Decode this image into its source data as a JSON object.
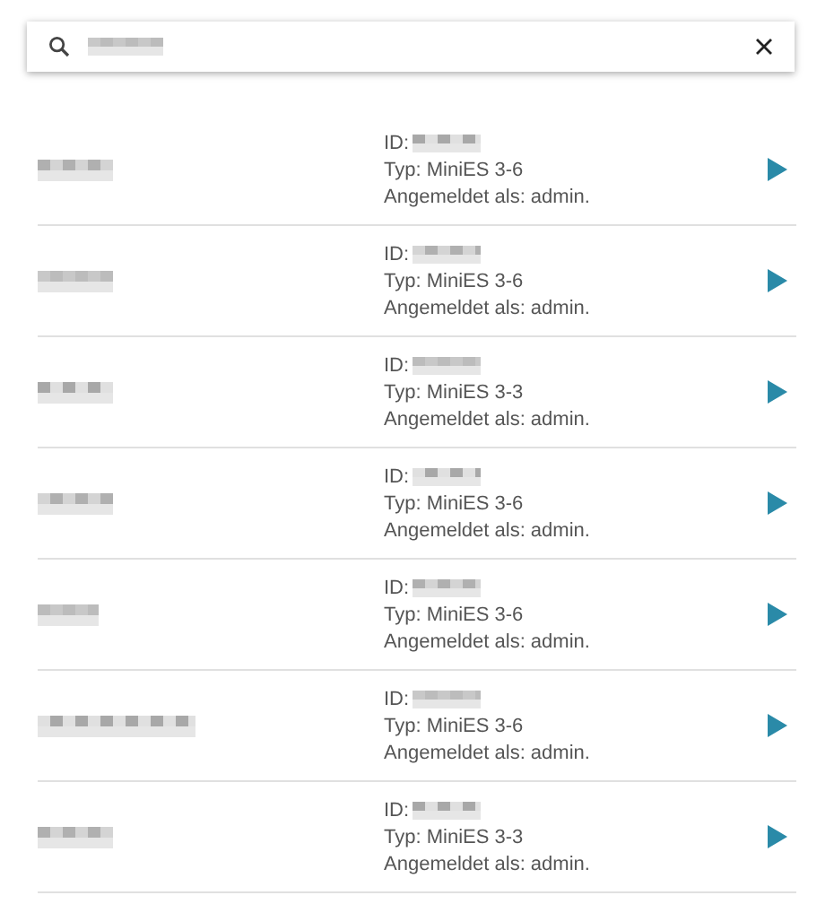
{
  "devices": [
    {
      "id_label": "ID:",
      "type": "Typ: MiniES 3-6",
      "login": "Angemeldet als: admin."
    },
    {
      "id_label": "ID:",
      "type": "Typ: MiniES 3-6",
      "login": "Angemeldet als: admin."
    },
    {
      "id_label": "ID:",
      "type": "Typ: MiniES 3-3",
      "login": "Angemeldet als: admin."
    },
    {
      "id_label": "ID:",
      "type": "Typ: MiniES 3-6",
      "login": "Angemeldet als: admin."
    },
    {
      "id_label": "ID:",
      "type": "Typ: MiniES 3-6",
      "login": "Angemeldet als: admin."
    },
    {
      "id_label": "ID:",
      "type": "Typ: MiniES 3-6",
      "login": "Angemeldet als: admin."
    },
    {
      "id_label": "ID:",
      "type": "Typ: MiniES 3-3",
      "login": "Angemeldet als: admin."
    }
  ]
}
